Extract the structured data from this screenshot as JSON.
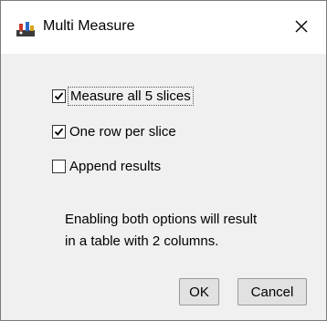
{
  "window": {
    "title": "Multi Measure",
    "title_icon": "imagej-app-icon",
    "close_icon": "close-icon"
  },
  "options": [
    {
      "label": "Measure all 5 slices",
      "checked": true,
      "focused": true
    },
    {
      "label": "One row per slice",
      "checked": true,
      "focused": false
    },
    {
      "label": "Append results",
      "checked": false,
      "focused": false
    }
  ],
  "message": {
    "line1": "Enabling both options will result",
    "line2": "in a table with 2 columns."
  },
  "buttons": {
    "ok": "OK",
    "cancel": "Cancel"
  }
}
